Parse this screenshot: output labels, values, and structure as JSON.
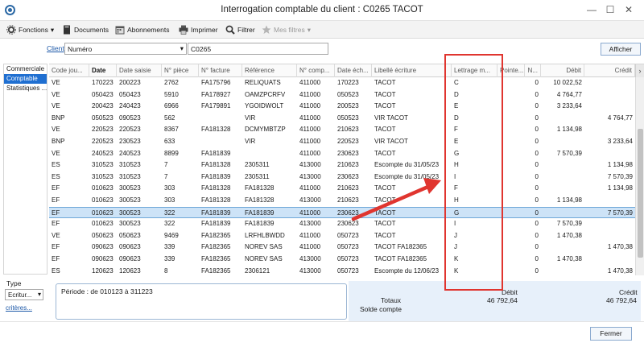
{
  "window": {
    "title": "Interrogation comptable du client : C0265 TACOT",
    "minimize_glyph": "—",
    "maximize_glyph": "☐",
    "close_glyph": "✕"
  },
  "toolbar": {
    "fonctions": "Fonctions",
    "documents": "Documents",
    "abonnements": "Abonnements",
    "imprimer": "Imprimer",
    "filtrer": "Filtrer",
    "mes_filtres": "Mes filtres",
    "dropdown_glyph": "▾"
  },
  "filter": {
    "client_label": "Client",
    "field_select": "Numéro",
    "client_value": "C0265",
    "afficher": "Afficher"
  },
  "left_panel": {
    "items": [
      "Commerciale",
      "Comptable",
      "Statistiques ..."
    ],
    "selected_index": 1
  },
  "grid": {
    "columns": [
      "Code jou...",
      "Date",
      "Date saisie",
      "N° pièce",
      "N° facture",
      "Référence",
      "N° comp...",
      "Date éch...",
      "Libellé écriture",
      "Lettrage m...",
      "Pointe...",
      "N...",
      "Débit",
      "Crédit"
    ],
    "sorted_column": "Date",
    "scroll_right_glyph": "›",
    "selected_row": 11,
    "rows": [
      [
        "VE",
        "170223",
        "200223",
        "2762",
        "FA175796",
        "RELIQUATS",
        "411000",
        "170223",
        "TACOT",
        "C",
        "",
        "0",
        "10 022,52",
        ""
      ],
      [
        "VE",
        "050423",
        "050423",
        "5910",
        "FA178927",
        "OAMZPCRFV",
        "411000",
        "050523",
        "TACOT",
        "D",
        "",
        "0",
        "4 764,77",
        ""
      ],
      [
        "VE",
        "200423",
        "240423",
        "6966",
        "FA179891",
        "YGOIDWOLT",
        "411000",
        "200523",
        "TACOT",
        "E",
        "",
        "0",
        "3 233,64",
        ""
      ],
      [
        "BNP",
        "050523",
        "090523",
        "562",
        "",
        "VIR",
        "411000",
        "050523",
        "VIR TACOT",
        "D",
        "",
        "0",
        "",
        "4 764,77"
      ],
      [
        "VE",
        "220523",
        "220523",
        "8367",
        "FA181328",
        "DCMYMBTZP",
        "411000",
        "210623",
        "TACOT",
        "F",
        "",
        "0",
        "1 134,98",
        ""
      ],
      [
        "BNP",
        "220523",
        "230523",
        "633",
        "",
        "VIR",
        "411000",
        "220523",
        "VIR TACOT",
        "E",
        "",
        "0",
        "",
        "3 233,64"
      ],
      [
        "VE",
        "240523",
        "240523",
        "8899",
        "FA181839",
        "",
        "411000",
        "230623",
        "TACOT",
        "G",
        "",
        "0",
        "7 570,39",
        ""
      ],
      [
        "ES",
        "310523",
        "310523",
        "7",
        "FA181328",
        "2305311",
        "413000",
        "210623",
        "Escompte du 31/05/23",
        "H",
        "",
        "0",
        "",
        "1 134,98"
      ],
      [
        "ES",
        "310523",
        "310523",
        "7",
        "FA181839",
        "2305311",
        "413000",
        "230623",
        "Escompte du 31/05/23",
        "I",
        "",
        "0",
        "",
        "7 570,39"
      ],
      [
        "EF",
        "010623",
        "300523",
        "303",
        "FA181328",
        "FA181328",
        "411000",
        "210623",
        "TACOT",
        "F",
        "",
        "0",
        "",
        "1 134,98"
      ],
      [
        "EF",
        "010623",
        "300523",
        "303",
        "FA181328",
        "FA181328",
        "413000",
        "210623",
        "TACOT",
        "H",
        "",
        "0",
        "1 134,98",
        ""
      ],
      [
        "EF",
        "010623",
        "300523",
        "322",
        "FA181839",
        "FA181839",
        "411000",
        "230623",
        "TACOT",
        "G",
        "",
        "0",
        "",
        "7 570,39"
      ],
      [
        "EF",
        "010623",
        "300523",
        "322",
        "FA181839",
        "FA181839",
        "413000",
        "230623",
        "TACOT",
        "I",
        "",
        "0",
        "7 570,39",
        ""
      ],
      [
        "VE",
        "050623",
        "050623",
        "9469",
        "FA182365",
        "LRFHLBWDD",
        "411000",
        "050723",
        "TACOT",
        "J",
        "",
        "0",
        "1 470,38",
        ""
      ],
      [
        "EF",
        "090623",
        "090623",
        "339",
        "FA182365",
        "NOREV SAS",
        "411000",
        "050723",
        "TACOT FA182365",
        "J",
        "",
        "0",
        "",
        "1 470,38"
      ],
      [
        "EF",
        "090623",
        "090623",
        "339",
        "FA182365",
        "NOREV SAS",
        "413000",
        "050723",
        "TACOT FA182365",
        "K",
        "",
        "0",
        "1 470,38",
        ""
      ],
      [
        "ES",
        "120623",
        "120623",
        "8",
        "FA182365",
        "2306121",
        "413000",
        "050723",
        "Escompte du 12/06/23",
        "K",
        "",
        "0",
        "",
        "1 470,38"
      ]
    ]
  },
  "bottom": {
    "type_label": "Type",
    "type_value": "Ecritur...",
    "criteres": "critères...",
    "period": "Période : de 010123 à 311223",
    "debit_label": "Débit",
    "credit_label": "Crédit",
    "totaux_label": "Totaux",
    "solde_label": "Solde compte",
    "total_debit": "46 792,64",
    "total_credit": "46 792,64"
  },
  "footer": {
    "fermer": "Fermer"
  },
  "colors": {
    "accent": "#1f6fd1",
    "selection": "#cde3f7",
    "annotation": "#e0352f"
  }
}
